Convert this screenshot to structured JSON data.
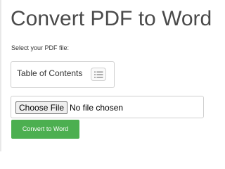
{
  "header": {
    "title": "Convert PDF to Word"
  },
  "form": {
    "prompt": "Select your PDF file:",
    "choose_file_label": "Choose File",
    "file_status": "No file chosen",
    "submit_label": "Convert to Word"
  },
  "toc": {
    "label": "Table of Contents",
    "toggle_icon": "list-icon"
  },
  "colors": {
    "accent": "#4caf50",
    "title_text": "#4a4a4a",
    "border": "#cfcfcf"
  }
}
